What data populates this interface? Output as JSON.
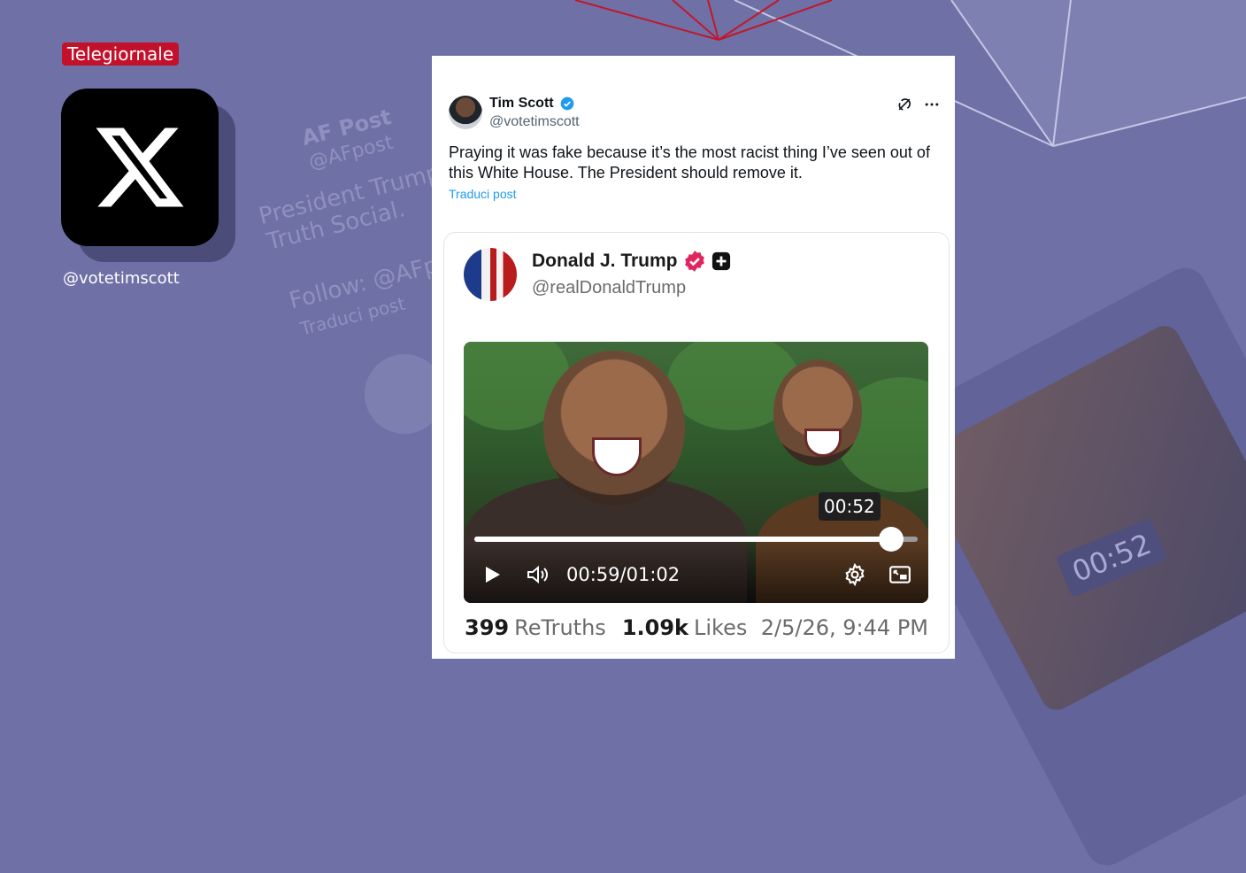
{
  "badge": "Telegiornale",
  "x_handle": "@votetimscott",
  "background": {
    "ghost_lines": [
      "AF Post",
      "@AFpost",
      "President Trump",
      "Truth Social.",
      "Follow: @AFp",
      "Traduci post"
    ],
    "ghost_time": "00:52"
  },
  "tweet": {
    "author_name": "Tim Scott",
    "author_handle": "@votetimscott",
    "text": "Praying it was fake because it’s the most racist thing I’ve seen out of this White House. The President should remove it.",
    "translate_label": "Traduci post"
  },
  "embedded_post": {
    "author_name": "Donald J. Trump",
    "author_handle": "@realDonaldTrump",
    "video": {
      "tooltip_time": "00:52",
      "current_time": "00:59",
      "separator": "/",
      "duration": "01:02",
      "progress": 0.94
    },
    "retruths_count": "399",
    "retruths_label": "ReTruths",
    "likes_count": "1.09k",
    "likes_label": "Likes",
    "date": "2/5/26, 9:44 PM"
  },
  "colors": {
    "badge": "#c3102b",
    "verified_blue": "#1d9bf0",
    "truth_badge": "#e0245e"
  }
}
